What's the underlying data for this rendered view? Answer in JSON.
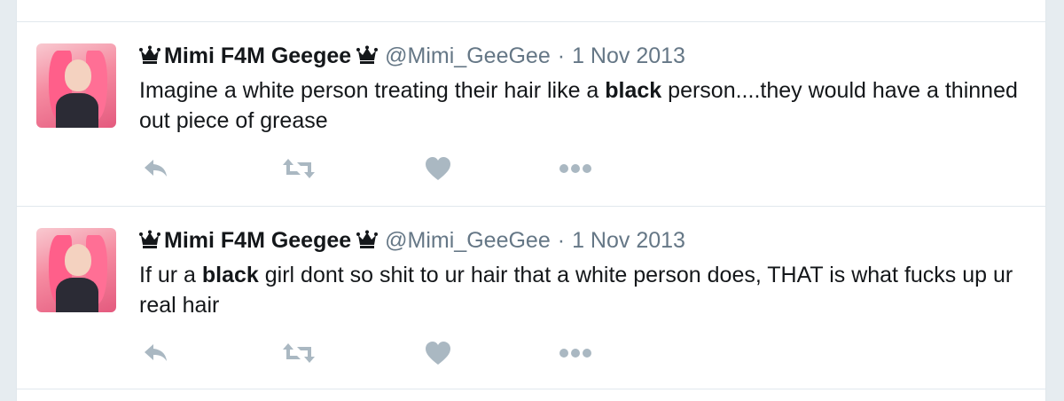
{
  "tweets": [
    {
      "display_name": "Mimi F4M Geegee",
      "handle": "@Mimi_GeeGee",
      "separator": "·",
      "date": "1 Nov 2013",
      "text_before": "Imagine a white person treating their hair like a ",
      "text_bold": "black",
      "text_after": " person....they would have a thinned out piece of grease"
    },
    {
      "display_name": "Mimi F4M Geegee",
      "handle": "@Mimi_GeeGee",
      "separator": "·",
      "date": "1 Nov 2013",
      "text_before": "If ur a ",
      "text_bold": "black",
      "text_after": " girl dont so shit to ur hair that a white person does, THAT is what fucks up ur real hair"
    }
  ],
  "icons": [
    "crown-icon",
    "reply-icon",
    "retweet-icon",
    "like-icon",
    "more-icon"
  ],
  "colors": {
    "icon_gray": "#aab8c2",
    "meta_gray": "#657786",
    "text": "#14171a"
  }
}
